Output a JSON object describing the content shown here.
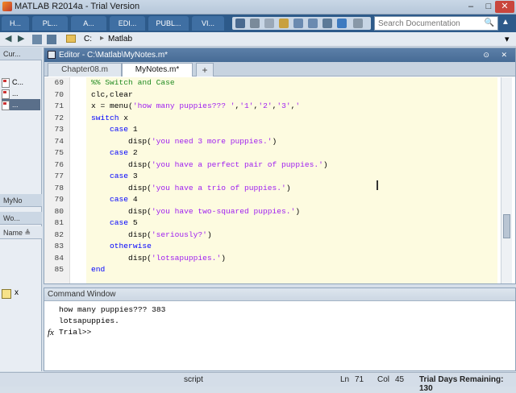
{
  "window": {
    "title": "MATLAB R2014a - Trial Version",
    "minimize": "–",
    "maximize": "□",
    "close": "✕"
  },
  "ribbon": {
    "tabs": [
      "H...",
      "PL...",
      "A...",
      "EDI...",
      "PUBL...",
      "VI..."
    ],
    "search_placeholder": "Search Documentation",
    "collapse": "▲"
  },
  "address": {
    "drive": "C:",
    "separator": "▸",
    "folder": "Matlab",
    "back": "◀",
    "forward": "▶"
  },
  "left_panels": {
    "current_folder_header": "Cur...",
    "files": [
      "C...",
      "...",
      "..."
    ],
    "details_label": "MyNo",
    "workspace_header": "Wo...",
    "name_header": "Name ≜",
    "variable": "x"
  },
  "editor": {
    "header": "Editor - C:\\Matlab\\MyNotes.m*",
    "tabs": [
      "Chapter08.m",
      "MyNotes.m*",
      "+"
    ],
    "lines": [
      {
        "n": "69",
        "t": "%% Switch and Case",
        "cls": "cm"
      },
      {
        "n": "70",
        "t": "clc,clear",
        "cls": ""
      },
      {
        "n": "71",
        "t": "x = menu('how many puppies??? ','1','2','3','",
        "cls": ""
      },
      {
        "n": "72",
        "t": "switch x",
        "cls": ""
      },
      {
        "n": "73",
        "t": "    case 1",
        "cls": ""
      },
      {
        "n": "74",
        "t": "        disp('you need 3 more puppies.')",
        "cls": ""
      },
      {
        "n": "75",
        "t": "    case 2",
        "cls": ""
      },
      {
        "n": "76",
        "t": "        disp('you have a perfect pair of puppies.')",
        "cls": ""
      },
      {
        "n": "77",
        "t": "    case 3",
        "cls": ""
      },
      {
        "n": "78",
        "t": "        disp('you have a trio of puppies.')",
        "cls": ""
      },
      {
        "n": "79",
        "t": "    case 4",
        "cls": ""
      },
      {
        "n": "80",
        "t": "        disp('you have two-squared puppies.')",
        "cls": ""
      },
      {
        "n": "81",
        "t": "    case 5",
        "cls": ""
      },
      {
        "n": "82",
        "t": "        disp('seriously?')",
        "cls": ""
      },
      {
        "n": "83",
        "t": "    otherwise",
        "cls": ""
      },
      {
        "n": "84",
        "t": "        disp('lotsapuppies.')",
        "cls": ""
      },
      {
        "n": "85",
        "t": "end",
        "cls": ""
      }
    ]
  },
  "command_window": {
    "header": "Command Window",
    "output": [
      "how many puppies??? 383",
      "lotsapuppies.",
      "Trial>>"
    ],
    "fx": "fx"
  },
  "status": {
    "mode": "script",
    "ln_label": "Ln",
    "ln": "71",
    "col_label": "Col",
    "col": "45",
    "trial": "Trial Days Remaining: 130"
  },
  "colors": {
    "keyword": "#0000ff",
    "comment": "#228b22",
    "string": "#a020f0",
    "cell_highlight": "#fdfbe0"
  }
}
